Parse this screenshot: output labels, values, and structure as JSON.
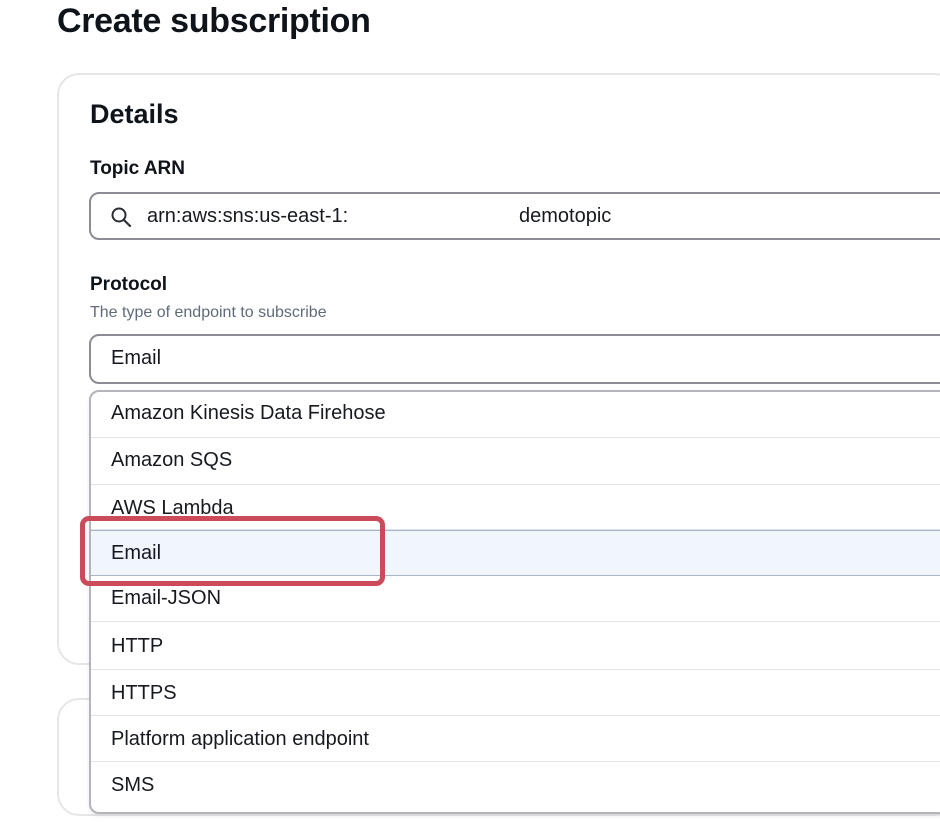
{
  "page": {
    "title": "Create subscription"
  },
  "details": {
    "title": "Details",
    "topic_arn": {
      "label": "Topic ARN",
      "value_prefix": "arn:aws:sns:us-east-1:",
      "value_topic": "demotopic",
      "icon": "search-icon"
    },
    "protocol": {
      "label": "Protocol",
      "description": "The type of endpoint to subscribe",
      "selected": "Email",
      "options": [
        "Amazon Kinesis Data Firehose",
        "Amazon SQS",
        "AWS Lambda",
        "Email",
        "Email-JSON",
        "HTTP",
        "HTTPS",
        "Platform application endpoint",
        "SMS"
      ]
    }
  },
  "colors": {
    "highlight": "#cc4b5a",
    "selected_option_bg": "#f1f6fc",
    "input_border": "#8c8c94"
  }
}
